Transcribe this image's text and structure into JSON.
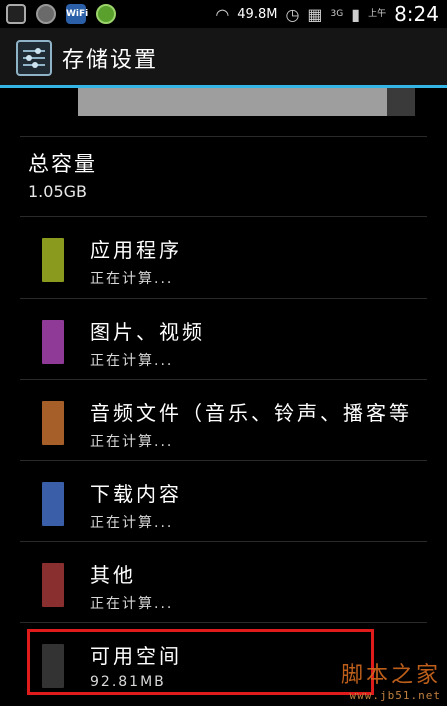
{
  "status_bar": {
    "speed": "49.8M",
    "time": "8:24",
    "am_pm": "上午",
    "wifi_badge": "WiFi",
    "network": "3G"
  },
  "header": {
    "title": "存储设置",
    "icon": "settings-sliders-icon"
  },
  "total": {
    "label": "总容量",
    "value": "1.05GB"
  },
  "categories": [
    {
      "label": "应用程序",
      "status": "正在计算...",
      "color": "#8a9a1e"
    },
    {
      "label": "图片、视频",
      "status": "正在计算...",
      "color": "#8e3a96"
    },
    {
      "label": "音频文件（音乐、铃声、播客等",
      "status": "正在计算...",
      "color": "#a65f28"
    },
    {
      "label": "下载内容",
      "status": "正在计算...",
      "color": "#3a5fa8"
    },
    {
      "label": "其他",
      "status": "正在计算...",
      "color": "#8a2f2f"
    },
    {
      "label": "可用空间",
      "status": "92.81MB",
      "color": "#333333"
    }
  ],
  "colors": {
    "accent": "#33b5e5",
    "highlight": "#e01b1b",
    "used_bar": "#9e9e9e",
    "free_bar": "#3a3a3a"
  },
  "watermark": {
    "title": "脚本之家",
    "url": "www.jb51.net"
  }
}
